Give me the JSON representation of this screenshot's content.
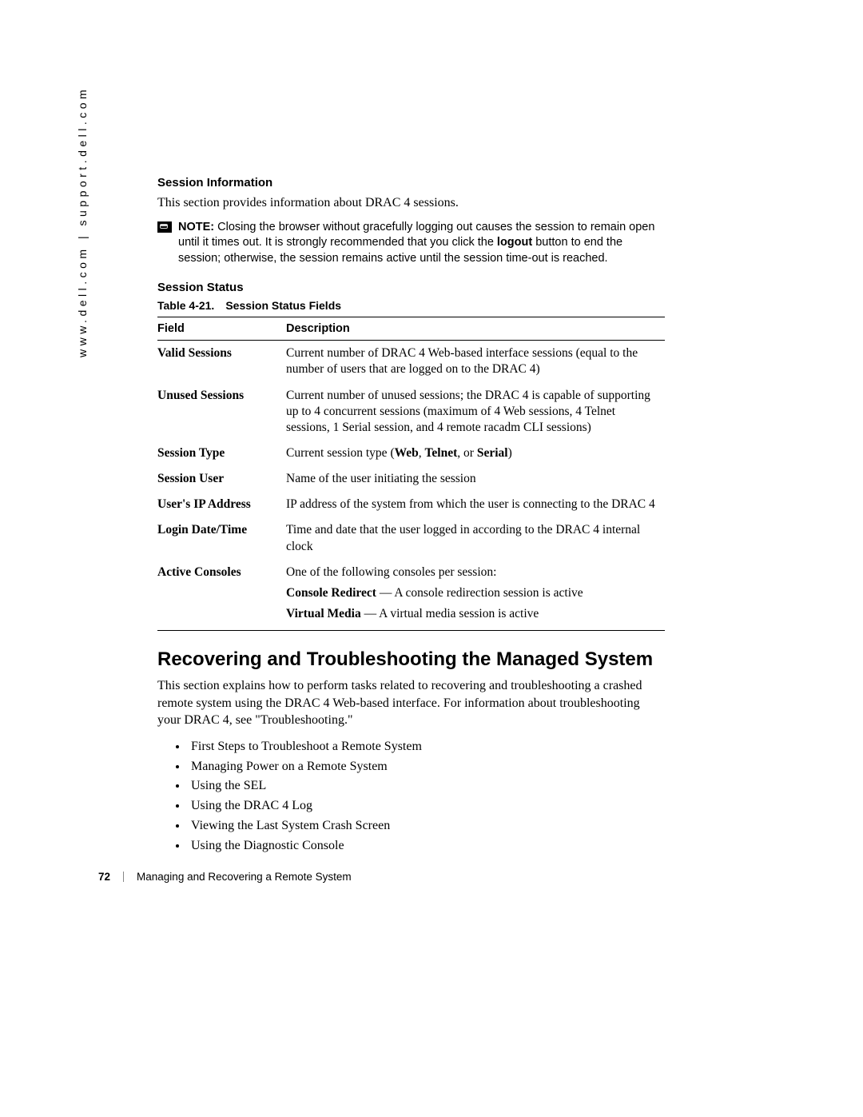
{
  "side_url": "www.dell.com | support.dell.com",
  "session_info_heading": "Session Information",
  "session_info_para": "This section provides information about DRAC 4 sessions.",
  "note_label": "NOTE:",
  "note_body_a": " Closing the browser without gracefully logging out causes the session to remain open until it times out. It is strongly recommended that you click the ",
  "note_bold_inline": "logout",
  "note_body_b": " button to end the session; otherwise, the session remains active until the session time-out is reached.",
  "session_status_heading": "Session Status",
  "table_number": "Table 4-21.",
  "table_caption": "Session Status Fields",
  "col_field": "Field",
  "col_desc": "Description",
  "rows": {
    "r0": {
      "field": "Valid Sessions",
      "desc": "Current number of DRAC 4 Web-based interface sessions (equal to the number of users that are logged on to the DRAC 4)"
    },
    "r1": {
      "field": "Unused Sessions",
      "desc": "Current number of unused sessions; the DRAC 4 is capable of supporting up to 4 concurrent sessions (maximum of 4 Web sessions, 4 Telnet sessions, 1 Serial session, and 4 remote racadm CLI sessions)"
    },
    "r2": {
      "field": "Session Type",
      "desc_a": "Current session type (",
      "b1": "Web",
      "sep1": ", ",
      "b2": "Telnet",
      "sep2": ", or ",
      "b3": "Serial",
      "desc_b": ")"
    },
    "r3": {
      "field": "Session User",
      "desc": "Name of the user initiating the session"
    },
    "r4": {
      "field": "User's IP Address",
      "desc": "IP address of the system from which the user is connecting to the DRAC 4"
    },
    "r5": {
      "field": "Login Date/Time",
      "desc": "Time and date that the user logged in according to the DRAC 4 internal clock"
    },
    "r6": {
      "field": "Active Consoles",
      "desc": "One of the following consoles per session:",
      "sub1_b": "Console Redirect",
      "sub1_t": " — A console redirection session is active",
      "sub2_b": "Virtual Media",
      "sub2_t": " — A virtual media session is active"
    }
  },
  "recover_heading": "Recovering and Troubleshooting the Managed System",
  "recover_para": "This section explains how to perform tasks related to recovering and troubleshooting a crashed remote system using the DRAC 4 Web-based interface. For information about troubleshooting your DRAC 4, see \"Troubleshooting.\"",
  "bullets": {
    "b0": "First Steps to Troubleshoot a Remote System",
    "b1": "Managing Power on a Remote System",
    "b2": "Using the SEL",
    "b3": "Using the DRAC 4 Log",
    "b4": "Viewing the Last System Crash Screen",
    "b5": "Using the Diagnostic Console"
  },
  "footer_page": "72",
  "footer_title": "Managing and Recovering a Remote System"
}
